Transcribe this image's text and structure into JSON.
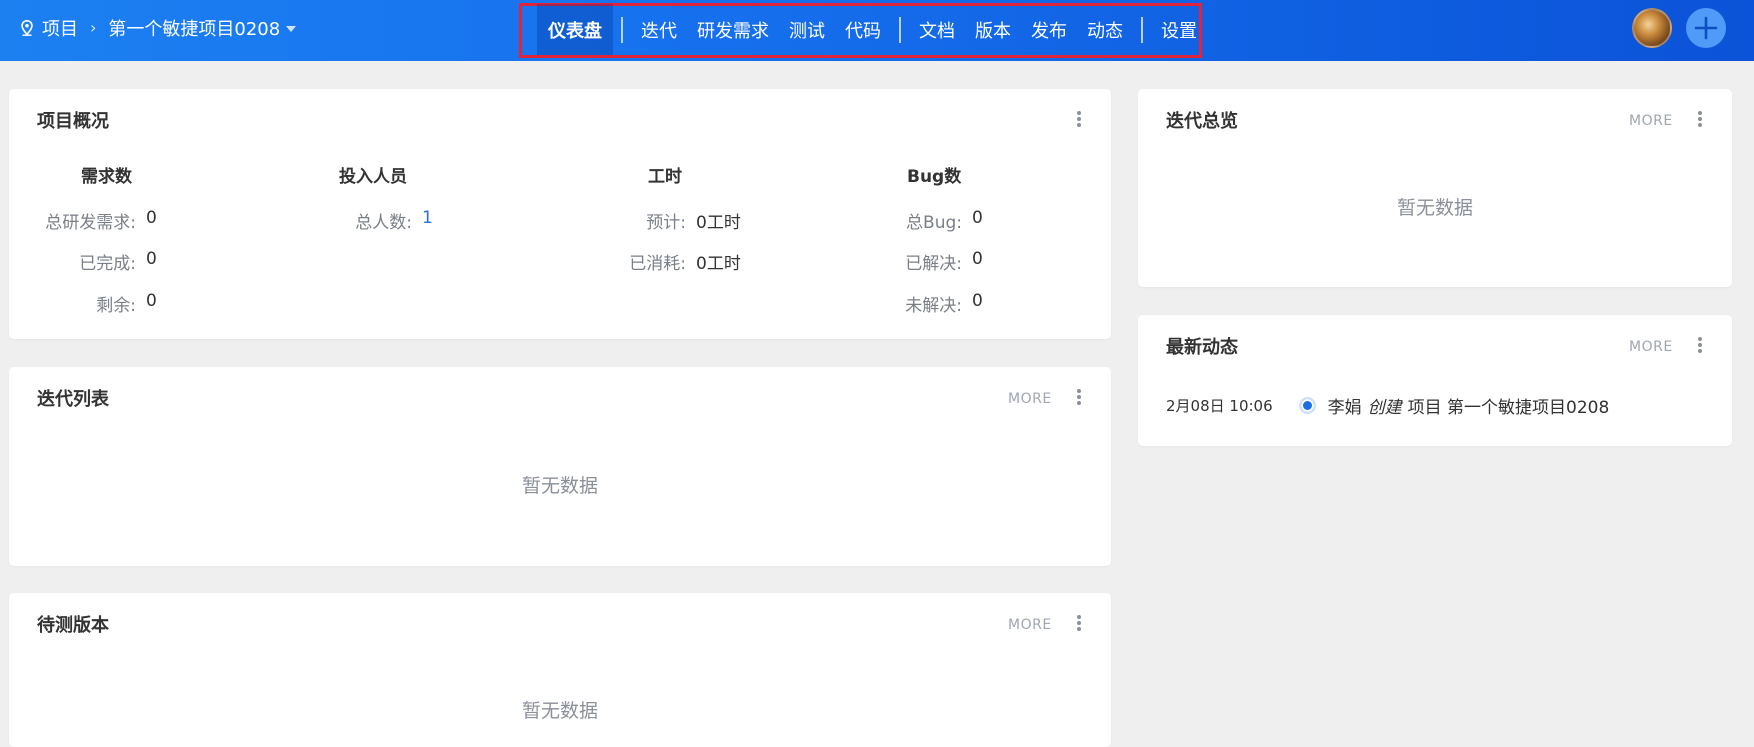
{
  "header": {
    "breadcrumb_root": "项目",
    "project_name": "第一个敏捷项目0208",
    "nav": [
      {
        "label": "仪表盘"
      },
      {
        "label": "迭代"
      },
      {
        "label": "研发需求"
      },
      {
        "label": "测试"
      },
      {
        "label": "代码"
      },
      {
        "label": "文档"
      },
      {
        "label": "版本"
      },
      {
        "label": "发布"
      },
      {
        "label": "动态"
      },
      {
        "label": "设置"
      }
    ]
  },
  "overview": {
    "title": "项目概况",
    "columns": [
      {
        "head": "需求数",
        "rows": [
          {
            "label": "总研发需求:",
            "value": "0"
          },
          {
            "label": "已完成:",
            "value": "0"
          },
          {
            "label": "剩余:",
            "value": "0"
          }
        ]
      },
      {
        "head": "投入人员",
        "rows": [
          {
            "label": "总人数:",
            "value": "1"
          }
        ]
      },
      {
        "head": "工时",
        "rows": [
          {
            "label": "预计:",
            "value": "0工时"
          },
          {
            "label": "已消耗:",
            "value": "0工时"
          }
        ]
      },
      {
        "head": "Bug数",
        "rows": [
          {
            "label": "总Bug:",
            "value": "0"
          },
          {
            "label": "已解决:",
            "value": "0"
          },
          {
            "label": "未解决:",
            "value": "0"
          }
        ]
      }
    ]
  },
  "iteration_list": {
    "title": "迭代列表",
    "more": "MORE",
    "empty": "暂无数据"
  },
  "pending_versions": {
    "title": "待测版本",
    "more": "MORE",
    "empty": "暂无数据"
  },
  "iteration_overview": {
    "title": "迭代总览",
    "more": "MORE",
    "empty": "暂无数据"
  },
  "activity": {
    "title": "最新动态",
    "more": "MORE",
    "items": [
      {
        "time": "2月08日 10:06",
        "user": "李娟",
        "verb": "创建",
        "object": "项目 第一个敏捷项目0208"
      }
    ]
  },
  "colors": {
    "header_start": "#1c80f1",
    "header_end": "#0b53d8",
    "highlight_box": "#e0243a",
    "link": "#2a6fdb"
  }
}
